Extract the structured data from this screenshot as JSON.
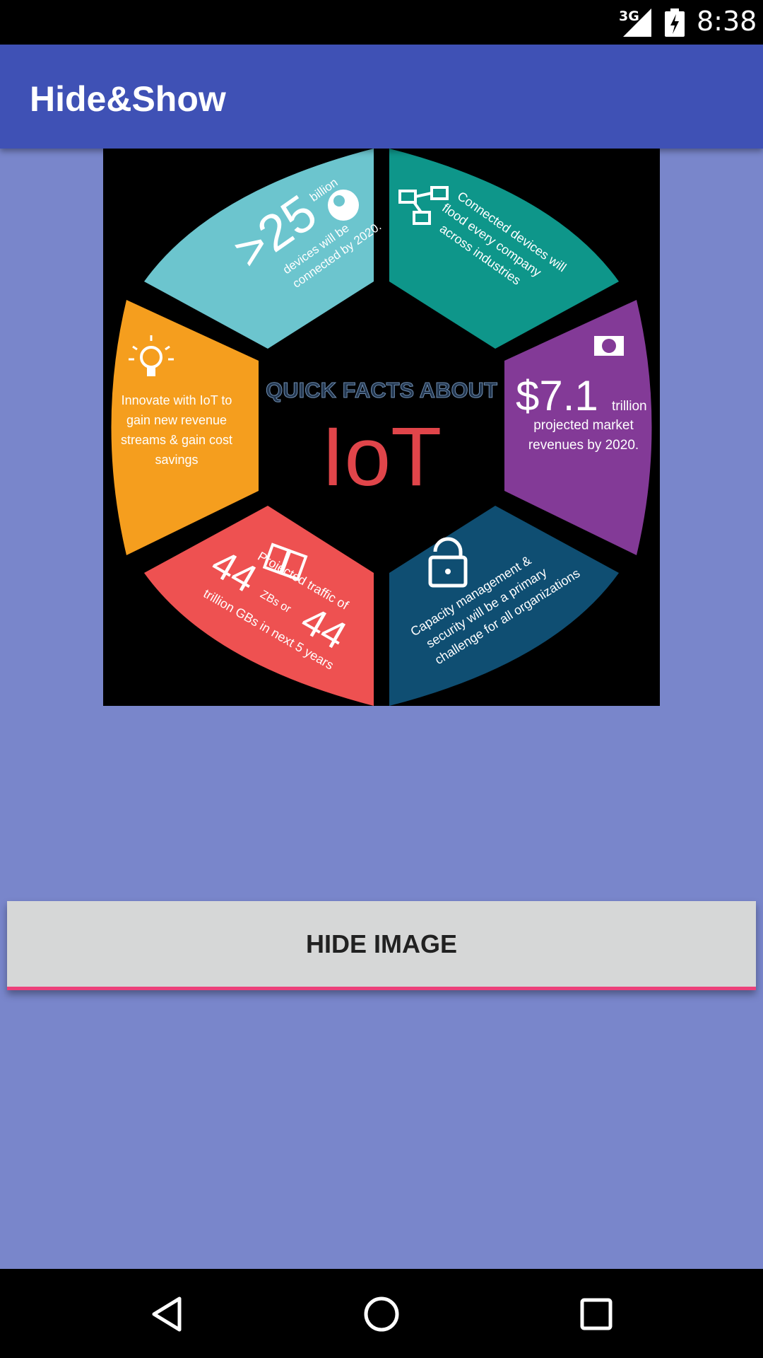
{
  "status_bar": {
    "network": "3G",
    "time": "8:38",
    "icons": [
      "signal-icon",
      "battery-icon"
    ]
  },
  "app_bar": {
    "title": "Hide&Show"
  },
  "image": {
    "center_heading": "QUICK FACTS ABOUT",
    "center_title": "IoT",
    "segments": [
      {
        "number": ">25",
        "unit": "billion",
        "text": [
          "devices will be",
          "connected by 2020."
        ],
        "color": "#6CC5CE",
        "icon": "globe-icon"
      },
      {
        "text": [
          "Connected devices will",
          "flood every company",
          "across industries"
        ],
        "color": "#0E968A",
        "icon": "network-icon"
      },
      {
        "number": "$7.1",
        "unit": "trillion",
        "text": [
          "projected market",
          "revenues by 2020."
        ],
        "color": "#833A97",
        "icon": "money-icon"
      },
      {
        "text": [
          "Capacity management &",
          "security will be a primary",
          "challenge for all organizations"
        ],
        "color": "#0F4E72",
        "icon": "lock-icon"
      },
      {
        "number": "44",
        "unit": "ZBs or",
        "number2": "44",
        "text": [
          "Projected traffic of",
          "trillion GBs in next 5 years"
        ],
        "color": "#EE5151",
        "icon": "server-icon"
      },
      {
        "text": [
          "Innovate with IoT to",
          "gain new revenue",
          "streams & gain cost",
          "savings"
        ],
        "color": "#F59E1E",
        "icon": "lightbulb-icon"
      }
    ]
  },
  "button": {
    "label": "HIDE IMAGE"
  },
  "nav_bar": {
    "icons": [
      "back-icon",
      "home-icon",
      "recents-icon"
    ]
  },
  "colors": {
    "background": "#7986CB",
    "primary": "#3F51B5",
    "accent": "#EC407A",
    "button": "#D6D7D7"
  }
}
